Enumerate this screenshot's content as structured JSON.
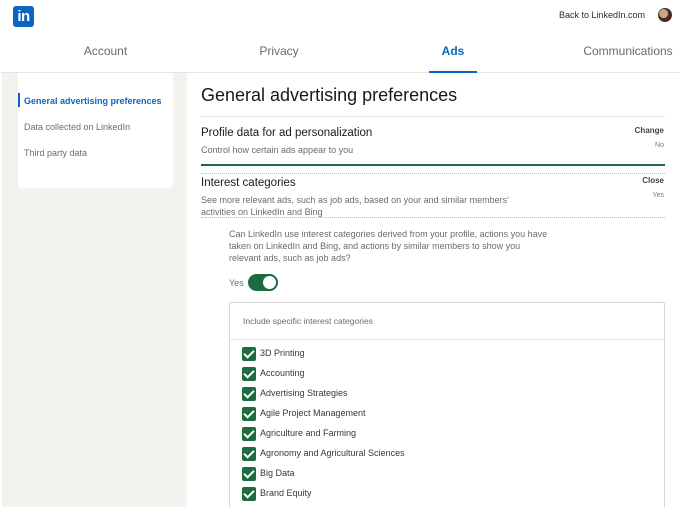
{
  "header": {
    "logo_text": "in",
    "back_link": "Back to LinkedIn.com"
  },
  "tabs": [
    {
      "label": "Account"
    },
    {
      "label": "Privacy"
    },
    {
      "label": "Ads",
      "active": true
    },
    {
      "label": "Communications"
    }
  ],
  "sidebar": {
    "items": [
      {
        "label": "General advertising preferences",
        "active": true
      },
      {
        "label": "Data collected on LinkedIn"
      },
      {
        "label": "Third party data"
      }
    ]
  },
  "main": {
    "title": "General advertising preferences",
    "profile_section": {
      "title": "Profile data for ad personalization",
      "description": "Control how certain ads appear to you",
      "action": "Change",
      "state": "No"
    },
    "interest_section": {
      "title": "Interest categories",
      "description": "See more relevant ads, such as job ads, based on your and similar members' activities on LinkedIn and Bing",
      "action": "Close",
      "state": "Yes",
      "question": "Can LinkedIn use interest categories derived from your profile, actions you have taken on LinkedIn and Bing, and actions by similar members to show you relevant ads, such as job ads?",
      "toggle_label": "Yes",
      "toggle_on": true,
      "categories_header": "Include specific interest categories",
      "categories": [
        {
          "label": "3D Printing",
          "checked": true
        },
        {
          "label": "Accounting",
          "checked": true
        },
        {
          "label": "Advertising Strategies",
          "checked": true
        },
        {
          "label": "Agile Project Management",
          "checked": true
        },
        {
          "label": "Agriculture and Farming",
          "checked": true
        },
        {
          "label": "Agronomy and Agricultural Sciences",
          "checked": true
        },
        {
          "label": "Big Data",
          "checked": true
        },
        {
          "label": "Brand Equity",
          "checked": true
        }
      ]
    }
  },
  "colors": {
    "linkedin_blue": "#0a66c2",
    "toggle_green": "#1d6b3e"
  },
  "icons": {
    "logo": "linkedin-logo-icon",
    "checkbox": "checkmark-icon"
  }
}
